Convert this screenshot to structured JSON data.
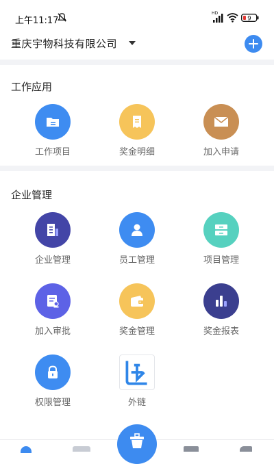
{
  "status_bar": {
    "time": "上午11:17",
    "network_label": "HD",
    "battery_level": "9",
    "icons": [
      "do-not-disturb-icon",
      "signal-icon",
      "wifi-icon",
      "battery-icon"
    ]
  },
  "header": {
    "company_name": "重庆宇物科技有限公司",
    "dropdown_icon": "caret-down-icon",
    "add_icon": "plus-icon"
  },
  "sections": {
    "work_apps": {
      "title": "工作应用",
      "items": [
        {
          "label": "工作项目",
          "icon": "folder-icon",
          "color": "#3e8cf1"
        },
        {
          "label": "奖金明细",
          "icon": "receipt-icon",
          "color": "#f6c45a"
        },
        {
          "label": "加入申请",
          "icon": "envelope-icon",
          "color": "#c98f54"
        }
      ]
    },
    "enterprise": {
      "title": "企业管理",
      "items": [
        {
          "label": "企业管理",
          "icon": "building-icon",
          "color": "#4345a7"
        },
        {
          "label": "员工管理",
          "icon": "person-icon",
          "color": "#3e8cf1"
        },
        {
          "label": "项目管理",
          "icon": "cabinet-icon",
          "color": "#56d1bf"
        },
        {
          "label": "加入审批",
          "icon": "approval-icon",
          "color": "#5d62e6"
        },
        {
          "label": "奖金管理",
          "icon": "wallet-icon",
          "color": "#f6c45a"
        },
        {
          "label": "奖金报表",
          "icon": "bar-chart-icon",
          "color": "#3b3f8f"
        },
        {
          "label": "权限管理",
          "icon": "lock-icon",
          "color": "#3e8cf1"
        },
        {
          "label": "外链",
          "icon": "external-link-icon",
          "color": "#3e8cf1"
        }
      ]
    }
  },
  "bottom_nav": {
    "center_icon": "basket-icon",
    "accent_color": "#3d8bf0"
  }
}
